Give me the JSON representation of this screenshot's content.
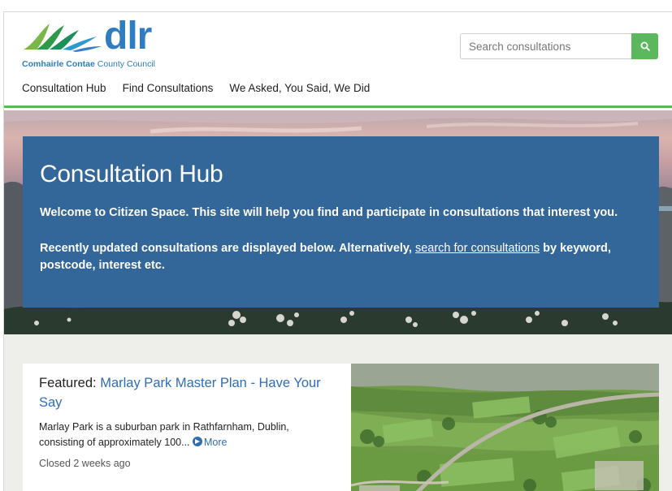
{
  "header": {
    "logo_text": "dlr",
    "logo_sub_bold": "Comhairle Contae",
    "logo_sub_rest": " County Council",
    "search_placeholder": "Search consultations"
  },
  "nav": {
    "items": [
      {
        "label": "Consultation Hub"
      },
      {
        "label": "Find Consultations"
      },
      {
        "label": "We Asked, You Said, We Did"
      }
    ]
  },
  "hero": {
    "title": "Consultation Hub",
    "intro": "Welcome to Citizen Space. This site will help you find and participate in consultations that interest you.",
    "recent_prefix": "Recently updated consultations are displayed below. Alternatively, ",
    "recent_link": "search for consultations",
    "recent_suffix": " by keyword, postcode, interest etc."
  },
  "featured": {
    "label": "Featured: ",
    "title": "Marlay Park Master Plan - Have Your Say",
    "description": "Marlay Park is a suburban park in Rathfarnham, Dublin, consisting of approximately 100...",
    "more_label": "More",
    "status": "Closed 2 weeks ago"
  },
  "colors": {
    "brand_blue": "#2f7dc0",
    "brand_green": "#5cb85c",
    "hero_panel": "#336699",
    "link": "#2f6db5"
  },
  "icons": {
    "search_button": "search-icon",
    "more": "chevron-circle-right-icon"
  }
}
